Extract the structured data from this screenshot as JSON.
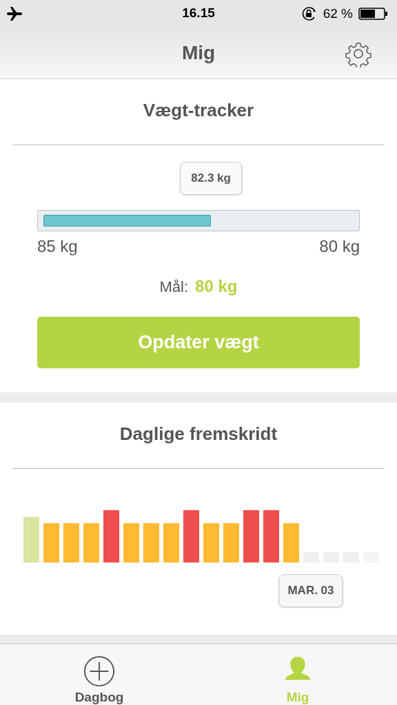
{
  "status_bar": {
    "time": "16.15",
    "battery": "62 %"
  },
  "nav_bar": {
    "title": "Mig"
  },
  "weight_tracker": {
    "title": "Vægt-tracker",
    "current": "82.3 kg",
    "level": 0.54,
    "start_label": "85 kg",
    "end_label": "80 kg",
    "goal_label": "Mål:",
    "goal_value": "80 kg",
    "button": "Opdater vægt"
  },
  "daily_progress": {
    "title": "Daglige fremskridt",
    "tooltip": "MAR. 03",
    "days": [
      {
        "color": "#d8e6a0",
        "kind": "good"
      },
      {
        "color": "#ffb932",
        "kind": "ok"
      },
      {
        "color": "#ffb932",
        "kind": "ok"
      },
      {
        "color": "#ffb932",
        "kind": "ok"
      },
      {
        "color": "#ef4e4c",
        "kind": "over"
      },
      {
        "color": "#ffb932",
        "kind": "ok"
      },
      {
        "color": "#ffb932",
        "kind": "ok"
      },
      {
        "color": "#ffb932",
        "kind": "ok"
      },
      {
        "color": "#ef4e4c",
        "kind": "over"
      },
      {
        "color": "#ffb932",
        "kind": "ok"
      },
      {
        "color": "#ffb932",
        "kind": "ok"
      },
      {
        "color": "#ef4e4c",
        "kind": "over"
      },
      {
        "color": "#ef4e4c",
        "kind": "over"
      },
      {
        "color": "#ffb932",
        "kind": "ok"
      },
      {
        "color": "#efefef",
        "kind": "empty"
      },
      {
        "color": "#efefef",
        "kind": "empty"
      },
      {
        "color": "#efefef",
        "kind": "empty"
      },
      {
        "color": "#f5f5f5",
        "kind": "empty"
      }
    ]
  },
  "tab_bar": {
    "tabs": [
      {
        "label": "Dagbog",
        "kind": "add",
        "selected": false
      },
      {
        "label": "Mig",
        "kind": "person",
        "selected": true
      }
    ]
  }
}
